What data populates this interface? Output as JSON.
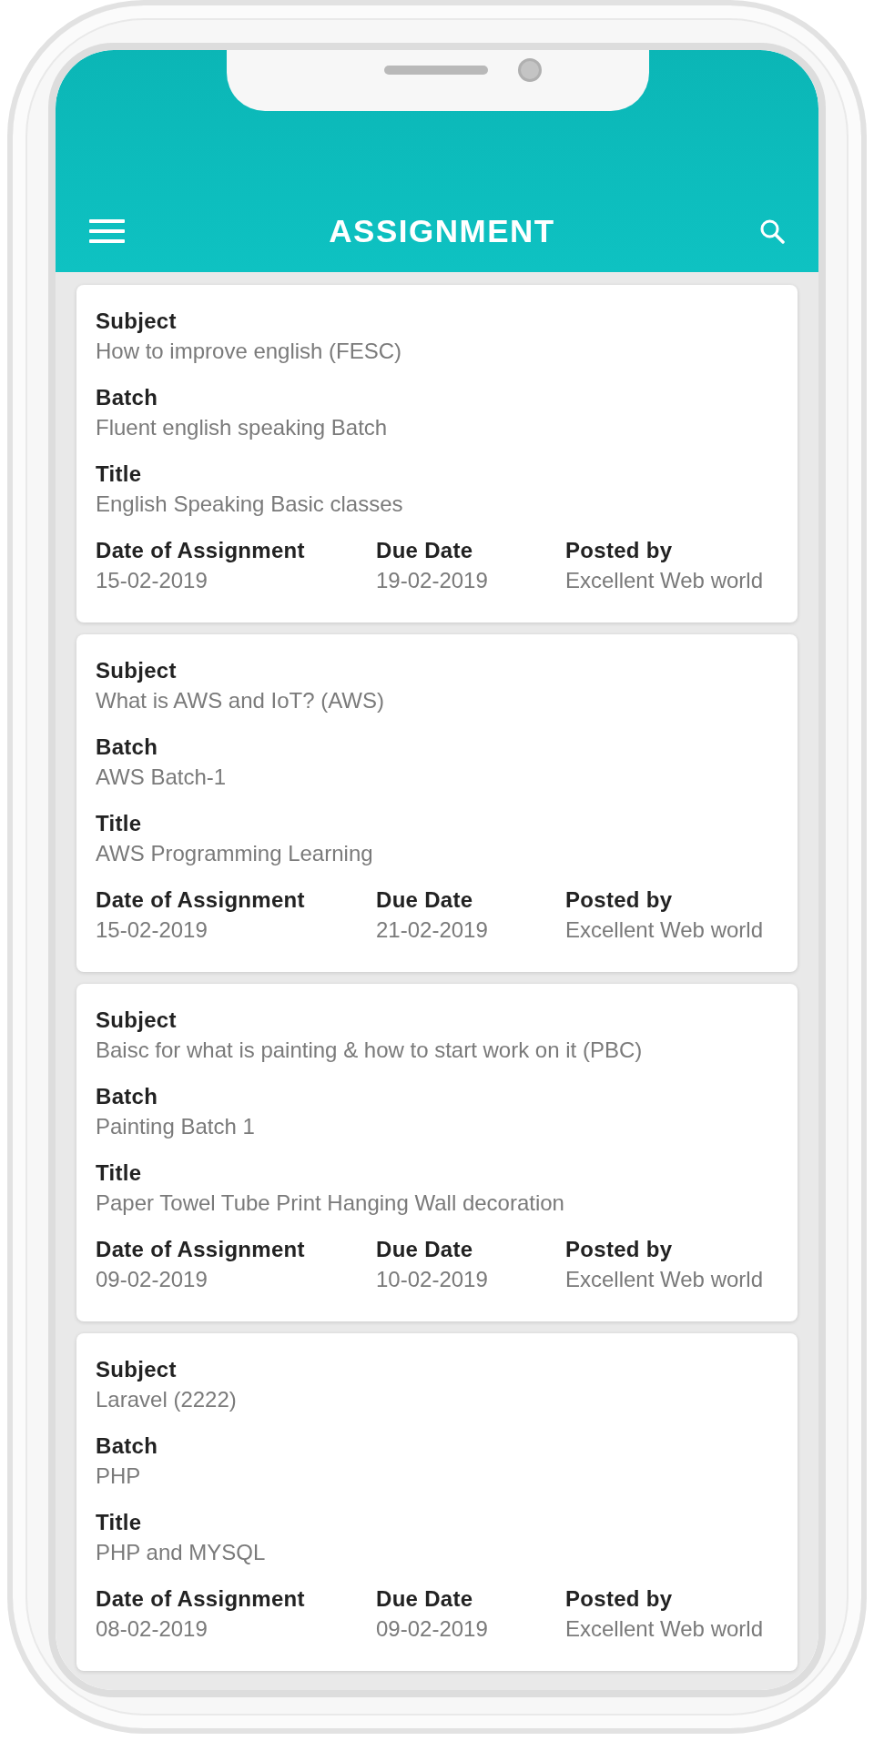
{
  "app_bar": {
    "title": "ASSIGNMENT"
  },
  "assignments": [
    {
      "details": [
        {
          "label": "Subject",
          "value": "How to improve english (FESC)"
        },
        {
          "label": "Batch",
          "value": "Fluent english speaking Batch"
        },
        {
          "label": "Title",
          "value": "English Speaking Basic classes"
        }
      ],
      "meta": [
        {
          "label": "Date of Assignment",
          "value": "15-02-2019"
        },
        {
          "label": "Due Date",
          "value": "19-02-2019"
        },
        {
          "label": "Posted by",
          "value": "Excellent Web world"
        }
      ]
    },
    {
      "details": [
        {
          "label": "Subject",
          "value": "What is AWS and IoT? (AWS)"
        },
        {
          "label": "Batch",
          "value": "AWS Batch-1"
        },
        {
          "label": "Title",
          "value": "AWS Programming Learning"
        }
      ],
      "meta": [
        {
          "label": "Date of Assignment",
          "value": "15-02-2019"
        },
        {
          "label": "Due Date",
          "value": "21-02-2019"
        },
        {
          "label": "Posted by",
          "value": "Excellent Web world"
        }
      ]
    },
    {
      "details": [
        {
          "label": "Subject",
          "value": "Baisc for what is painting & how to start work on it (PBC)"
        },
        {
          "label": "Batch",
          "value": "Painting Batch 1"
        },
        {
          "label": "Title",
          "value": "Paper Towel Tube Print Hanging Wall decoration"
        }
      ],
      "meta": [
        {
          "label": "Date of Assignment",
          "value": "09-02-2019"
        },
        {
          "label": "Due Date",
          "value": "10-02-2019"
        },
        {
          "label": "Posted by",
          "value": "Excellent Web world"
        }
      ]
    },
    {
      "details": [
        {
          "label": "Subject",
          "value": "Laravel (2222)"
        },
        {
          "label": "Batch",
          "value": "PHP"
        },
        {
          "label": "Title",
          "value": "PHP and MYSQL"
        }
      ],
      "meta": [
        {
          "label": "Date of Assignment",
          "value": "08-02-2019"
        },
        {
          "label": "Due Date",
          "value": "09-02-2019"
        },
        {
          "label": "Posted by",
          "value": "Excellent Web world"
        }
      ]
    }
  ]
}
